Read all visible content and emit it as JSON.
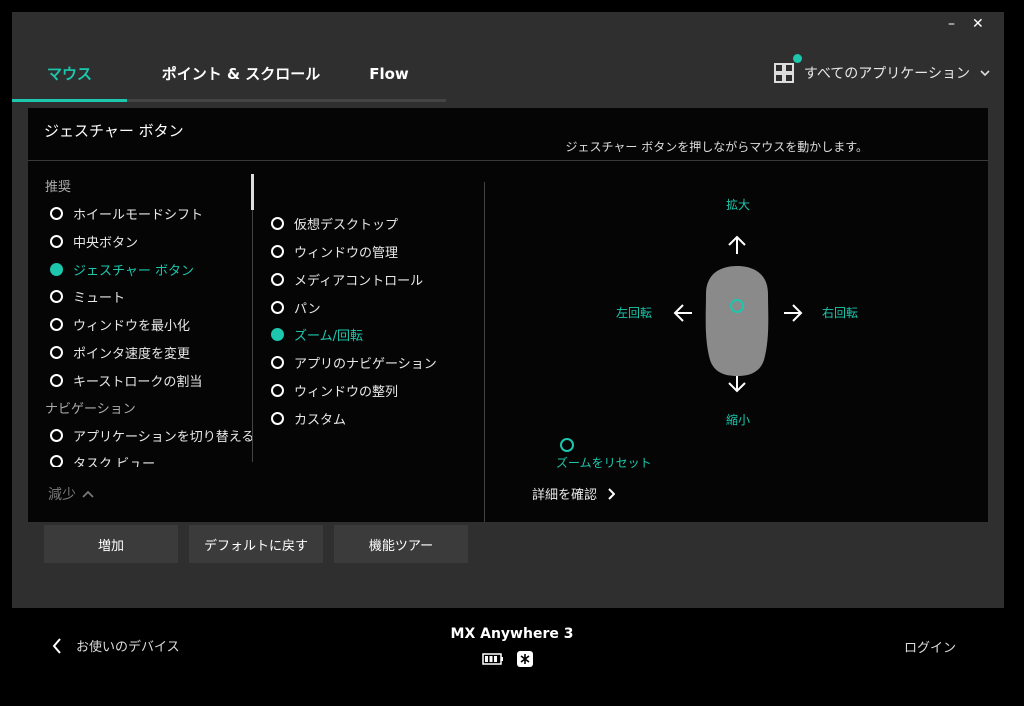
{
  "window": {
    "minimize_label": "–",
    "close_label": "✕"
  },
  "tabs": [
    {
      "label": "マウス",
      "active": true
    },
    {
      "label": "ポイント & スクロール",
      "active": false
    },
    {
      "label": "Flow",
      "active": false
    }
  ],
  "apps_selector": {
    "label": "すべてのアプリケーション",
    "icon": "apps-grid-icon"
  },
  "panel": {
    "title": "ジェスチャー ボタン",
    "hint": "ジェスチャー ボタンを押しながらマウスを動かします。",
    "sections": [
      {
        "label": "推奨",
        "items": [
          {
            "label": "ホイールモードシフト",
            "selected": false
          },
          {
            "label": "中央ボタン",
            "selected": false
          },
          {
            "label": "ジェスチャー ボタン",
            "selected": true
          },
          {
            "label": "ミュート",
            "selected": false
          },
          {
            "label": "ウィンドウを最小化",
            "selected": false
          },
          {
            "label": "ポインタ速度を変更",
            "selected": false
          },
          {
            "label": "キーストロークの割当",
            "selected": false
          }
        ]
      },
      {
        "label": "ナビゲーション",
        "items": [
          {
            "label": "アプリケーションを切り替える",
            "selected": false
          },
          {
            "label": "タスク ビュー",
            "selected": false
          }
        ]
      }
    ],
    "collapse_label": "減少",
    "gesture_options": [
      {
        "label": "仮想デスクトップ",
        "selected": false
      },
      {
        "label": "ウィンドウの管理",
        "selected": false
      },
      {
        "label": "メディアコントロール",
        "selected": false
      },
      {
        "label": "パン",
        "selected": false
      },
      {
        "label": "ズーム/回転",
        "selected": true
      },
      {
        "label": "アプリのナビゲーション",
        "selected": false
      },
      {
        "label": "ウィンドウの整列",
        "selected": false
      },
      {
        "label": "カスタム",
        "selected": false
      }
    ],
    "gesture_map": {
      "up": "拡大",
      "down": "縮小",
      "left": "左回転",
      "right": "右回転",
      "reset": "ズームをリセット"
    },
    "details_link": "詳細を確認"
  },
  "buttons": {
    "add": "増加",
    "reset": "デフォルトに戻す",
    "tour": "機能ツアー"
  },
  "footer": {
    "back_label": "お使いのデバイス",
    "device_name": "MX Anywhere 3",
    "login_label": "ログイン"
  },
  "colors": {
    "accent": "#1cc7ad",
    "background": "#2f2f2f",
    "panel": "#050505"
  }
}
